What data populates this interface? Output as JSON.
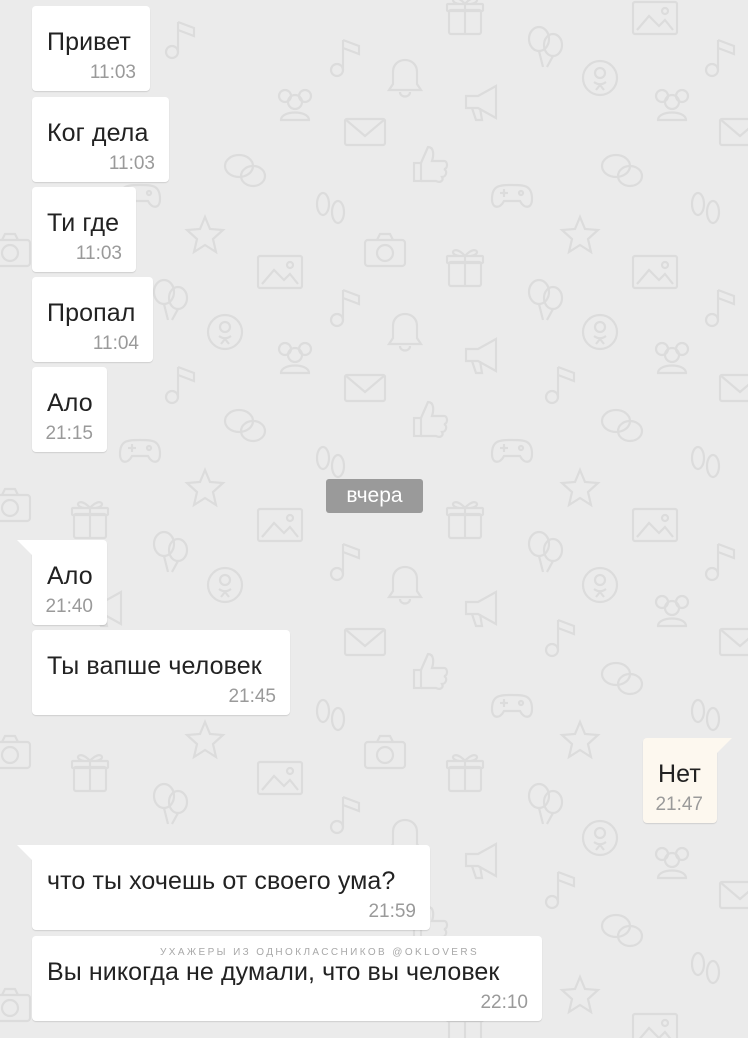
{
  "date_divider": "вчера",
  "watermark": "УХАЖЕРЫ ИЗ ОДНОКЛАССНИКОВ @OKLOVERS",
  "colors": {
    "background": "#ebebeb",
    "incoming_bubble": "#ffffff",
    "outgoing_bubble": "#fdf8ef",
    "time_text": "#9a9a9a",
    "date_chip": "#9a9a9a",
    "pattern_icons": "#dcdcdc"
  },
  "background_icons": [
    "gift-icon",
    "music-note-icon",
    "bell-icon",
    "people-icon",
    "megaphone-icon",
    "envelope-icon",
    "like-icon",
    "chat-bubbles-icon",
    "gamepad-icon",
    "footprints-icon",
    "star-icon",
    "camera-icon",
    "picture-icon",
    "balloons-icon",
    "odnoklassniki-logo-icon"
  ],
  "messages": [
    {
      "text": "Привет",
      "time": "11:03",
      "direction": "in"
    },
    {
      "text": "Ког дела",
      "time": "11:03",
      "direction": "in"
    },
    {
      "text": "Ти где",
      "time": "11:03",
      "direction": "in"
    },
    {
      "text": "Пропал",
      "time": "11:04",
      "direction": "in"
    },
    {
      "text": "Ало",
      "time": "21:15",
      "direction": "in"
    },
    {
      "text": "Ало",
      "time": "21:40",
      "direction": "in"
    },
    {
      "text": "Ты вапше человек",
      "time": "21:45",
      "direction": "in"
    },
    {
      "text": "Нет",
      "time": "21:47",
      "direction": "out"
    },
    {
      "text": "что ты хочешь от своего ума?",
      "time": "21:59",
      "direction": "in"
    },
    {
      "text": "Вы никогда не думали, что вы человек",
      "time": "22:10",
      "direction": "in"
    }
  ]
}
